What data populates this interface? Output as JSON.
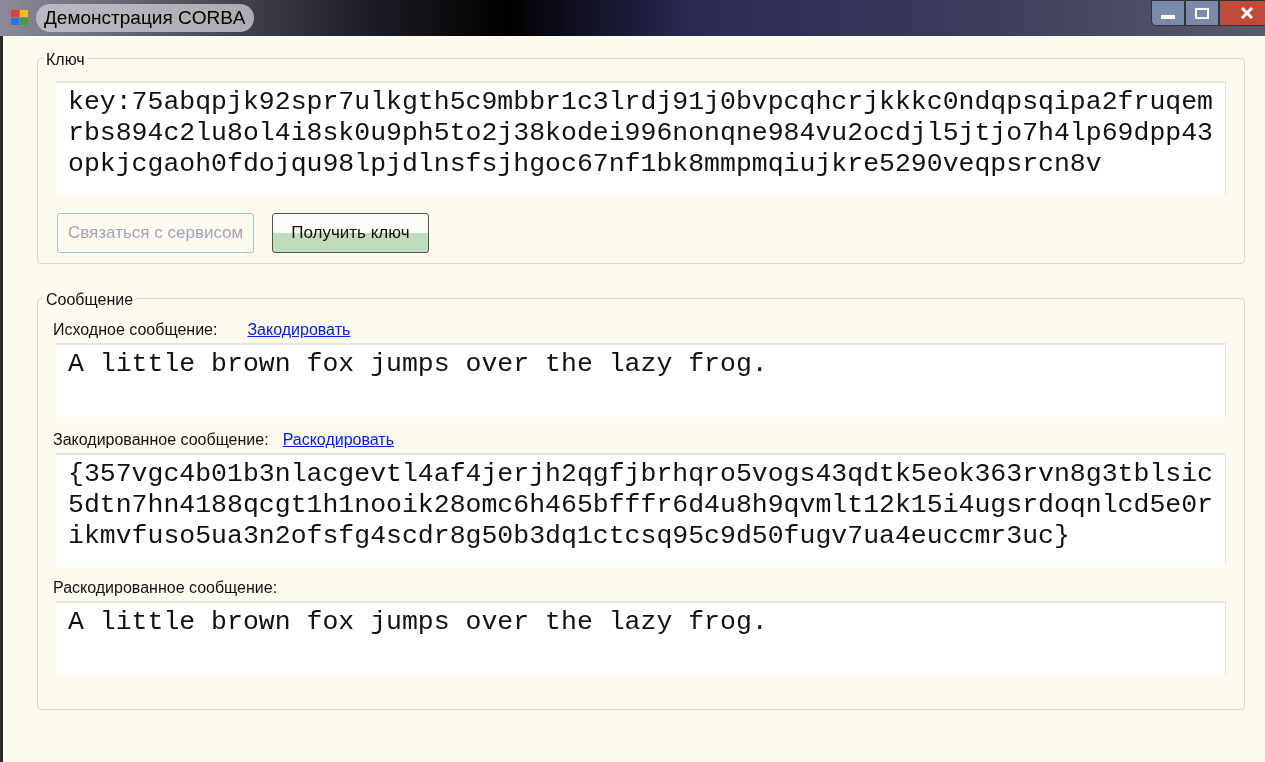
{
  "window": {
    "title": "Демонстрация CORBA"
  },
  "key_group": {
    "title": "Ключ",
    "lines": [
      "key:75abqpjk92spr7ulkgth5c9mbbr1c3lrdj91j0bvpcqhcrjkkkc0ndqpsqipa2fruqem",
      "rbs894c2lu8ol4i8sk0u9ph5to2j38kodei996nonqne984vu2ocdjl5jtjo7h4lp69dpp43",
      "opkjcgaoh0fdojqu98lpjdlnsfsjhgoc67nf1bk8mmpmqiujkre5290veqpsrcn8v"
    ],
    "buttons": [
      {
        "label": "Связаться с сервисом",
        "disabled": true
      },
      {
        "label": "Получить ключ",
        "disabled": false
      }
    ]
  },
  "message_group": {
    "title": "Сообщение",
    "fields": [
      {
        "label": "Исходное сообщение:",
        "link": "Закодировать",
        "lines": [
          "A little brown fox jumps over the lazy frog."
        ]
      },
      {
        "label": "Закодированное сообщение:",
        "link": "Раскодировать",
        "lines": [
          "{357vgc4b01b3nlacgevtl4af4jerjh2qgfjbrhqro5vogs43qdtk5eok363rvn8g3tblsic",
          "5dtn7hn4188qcgt1h1nooik28omc6h465bfffr6d4u8h9qvmlt12k15i4ugsrdoqnlcd5e0r",
          "ikmvfuso5ua3n2ofsfg4scdr8g50b3dq1ctcsq95c9d50fugv7ua4euccmr3uc}"
        ]
      },
      {
        "label": "Раскодированное сообщение:",
        "lines": [
          "A little brown fox jumps over the lazy frog."
        ]
      }
    ]
  }
}
